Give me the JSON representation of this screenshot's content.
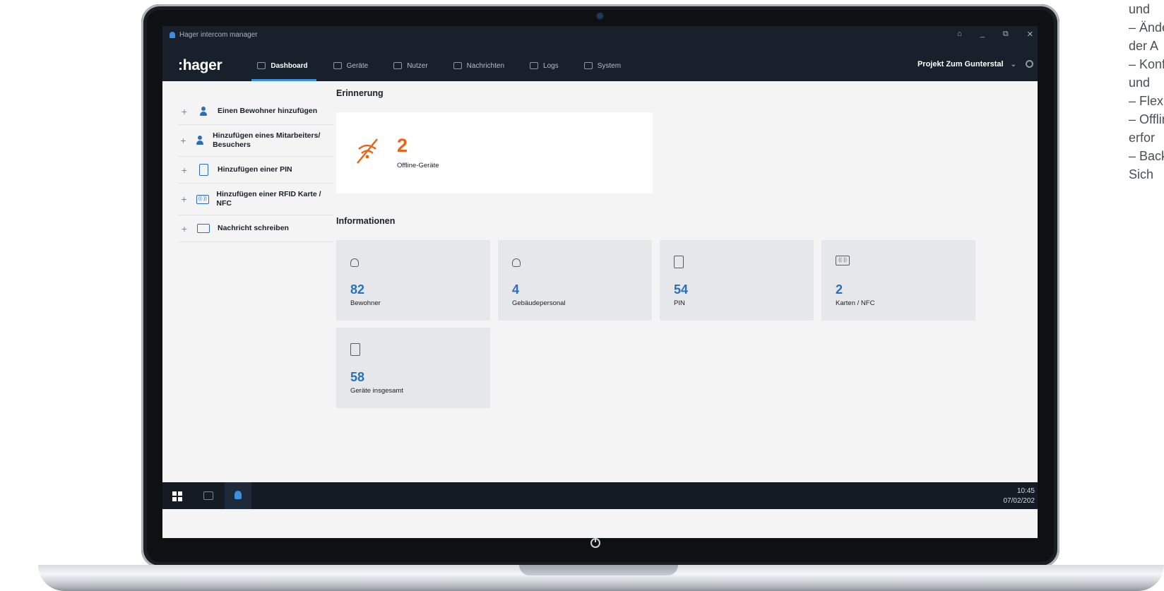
{
  "window": {
    "app_title": "Hager intercom manager",
    "controls": [
      "⌂",
      "_",
      "⧉",
      "✕"
    ]
  },
  "nav": {
    "logo": ":hager",
    "tabs": [
      {
        "label": "Dashboard",
        "active": true
      },
      {
        "label": "Geräte"
      },
      {
        "label": "Nutzer"
      },
      {
        "label": "Nachrichten"
      },
      {
        "label": "Logs"
      },
      {
        "label": "System"
      }
    ],
    "project": "Projekt Zum Gunterstal"
  },
  "sidebar": {
    "items": [
      {
        "label": "Einen Bewohner hinzufügen",
        "icon": "person-icon"
      },
      {
        "label": "Hinzufügen eines Mitarbeiters/ Besuchers",
        "icon": "group-icon"
      },
      {
        "label": "Hinzufügen einer PIN",
        "icon": "pin-icon"
      },
      {
        "label": "Hinzufügen einer RFID Karte / NFC",
        "icon": "rfid-icon"
      },
      {
        "label": "Nachricht schreiben",
        "icon": "message-icon"
      }
    ]
  },
  "reminder": {
    "heading": "Erinnerung",
    "count": "2",
    "label": "Offline-Geräte",
    "color": "#e8661c"
  },
  "info": {
    "heading": "Informationen",
    "cards": [
      {
        "value": "82",
        "label": "Bewohner"
      },
      {
        "value": "4",
        "label": "Gebäudepersonal"
      },
      {
        "value": "54",
        "label": "PIN"
      },
      {
        "value": "2",
        "label": "Karten / NFC"
      },
      {
        "value": "58",
        "label": "Geräte insgesamt"
      }
    ]
  },
  "taskbar": {
    "time": "10:45",
    "date": "07/02/202"
  },
  "sidetext": {
    "lines": [
      "und",
      "– Ände",
      "der A",
      "– Konf",
      "und",
      "– Flexi",
      "– Offlir",
      "erfor",
      "– Back",
      "Sich"
    ]
  }
}
